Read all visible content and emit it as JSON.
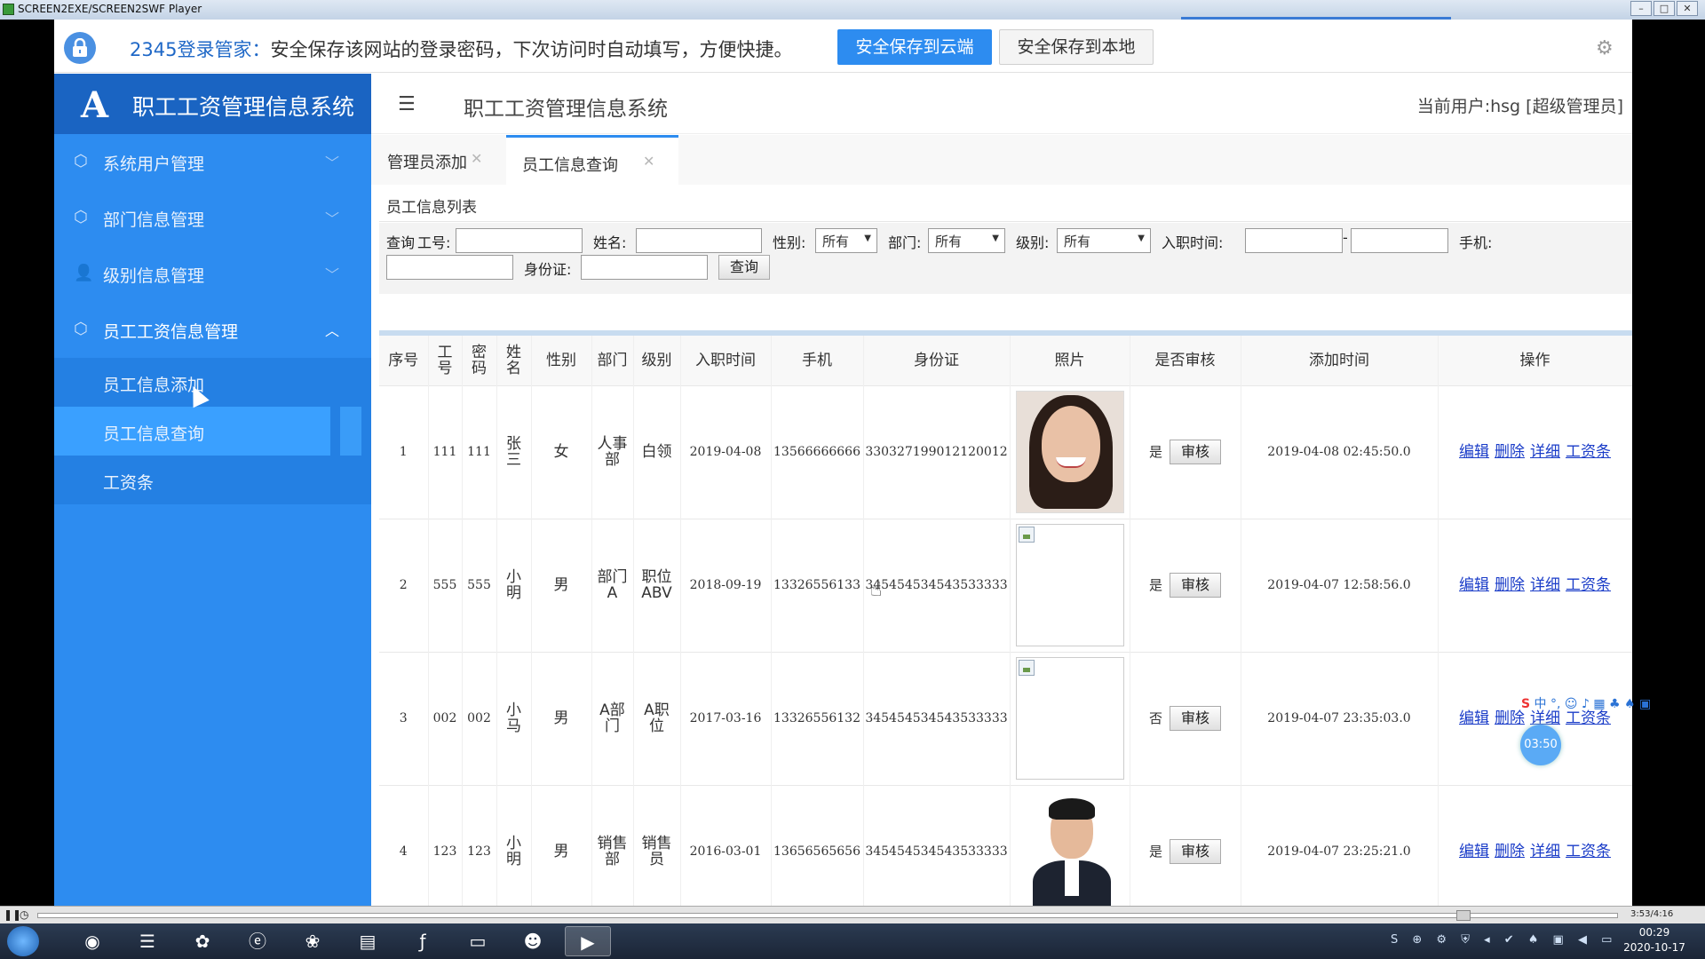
{
  "player": {
    "title": "SCREEN2EXE/SCREEN2SWF Player",
    "window_buttons": [
      "–",
      "□",
      "✕"
    ],
    "elapsed": "3:53/4:16"
  },
  "pwbar": {
    "brand": "2345登录管家：",
    "message": "安全保存该网站的登录密码，下次访问时自动填写，方便快捷。",
    "btn_cloud": "安全保存到云端",
    "btn_local": "安全保存到本地"
  },
  "app": {
    "brand_title": "职工工资管理信息系统",
    "header_title": "职工工资管理信息系统",
    "current_user": "当前用户:hsg [超级管理员]"
  },
  "sidebar": {
    "items": [
      {
        "label": "系统用户管理",
        "icon": "cube-icon"
      },
      {
        "label": "部门信息管理",
        "icon": "cube-icon"
      },
      {
        "label": "级别信息管理",
        "icon": "user-icon"
      },
      {
        "label": "员工工资信息管理",
        "icon": "cube-icon"
      }
    ],
    "subitems": [
      {
        "label": "员工信息添加"
      },
      {
        "label": "员工信息查询"
      },
      {
        "label": "工资条"
      }
    ]
  },
  "tabs": [
    {
      "label": "管理员添加"
    },
    {
      "label": "员工信息查询"
    }
  ],
  "list_title": "员工信息列表",
  "search": {
    "query_label": "查询",
    "emp_no_label": "工号:",
    "name_label": "姓名:",
    "gender_label": "性别:",
    "gender_value": "所有",
    "dept_label": "部门:",
    "dept_value": "所有",
    "level_label": "级别:",
    "level_value": "所有",
    "hire_label": "入职时间:",
    "dash": "-",
    "phone_label": "手机:",
    "id_label": "身份证:",
    "submit": "查询"
  },
  "table": {
    "headers": [
      "序号",
      "工号",
      "密码",
      "姓名",
      "性别",
      "部门",
      "级别",
      "入职时间",
      "手机",
      "身份证",
      "照片",
      "是否审核",
      "添加时间",
      "操作"
    ],
    "audit_btn": "审核",
    "ops": [
      "编辑",
      "删除",
      "详细",
      "工资条"
    ],
    "rows": [
      {
        "no": "1",
        "emp_no": "111",
        "pwd": "111",
        "name": "张三",
        "gender": "女",
        "dept": "人事部",
        "level": "白领",
        "hire": "2019-04-08",
        "phone": "13566666666",
        "idcard": "330327199012120012",
        "photo": "woman-photo",
        "audited": "是",
        "added": "2019-04-08 02:45:50.0"
      },
      {
        "no": "2",
        "emp_no": "555",
        "pwd": "555",
        "name": "小明",
        "gender": "男",
        "dept": "部门A",
        "level": "职位ABV",
        "hire": "2018-09-19",
        "phone": "13326556133",
        "idcard": "345454534543533333",
        "photo": "broken-image",
        "audited": "是",
        "added": "2019-04-07 12:58:56.0"
      },
      {
        "no": "3",
        "emp_no": "002",
        "pwd": "002",
        "name": "小马",
        "gender": "男",
        "dept": "A部门",
        "level": "A职位",
        "hire": "2017-03-16",
        "phone": "13326556132",
        "idcard": "345454534543533333",
        "photo": "broken-image",
        "audited": "否",
        "added": "2019-04-07 23:35:03.0"
      },
      {
        "no": "4",
        "emp_no": "123",
        "pwd": "123",
        "name": "小明",
        "gender": "男",
        "dept": "销售部",
        "level": "销售员",
        "hire": "2016-03-01",
        "phone": "13656565656",
        "idcard": "345454534543533333",
        "photo": "man-photo",
        "audited": "是",
        "added": "2019-04-07 23:25:21.0"
      }
    ]
  },
  "overlay": {
    "ime": "中 °, ☺ ♪ ▦ ♣ ♠ ▣",
    "timer": "03:50"
  },
  "taskbar": {
    "time": "00:29",
    "date": "2020-10-17"
  },
  "colors": {
    "sidebar": "#2d8cf0",
    "brand": "#1a64c2",
    "accent": "#2d8cf0",
    "link": "#1a3cc8"
  }
}
